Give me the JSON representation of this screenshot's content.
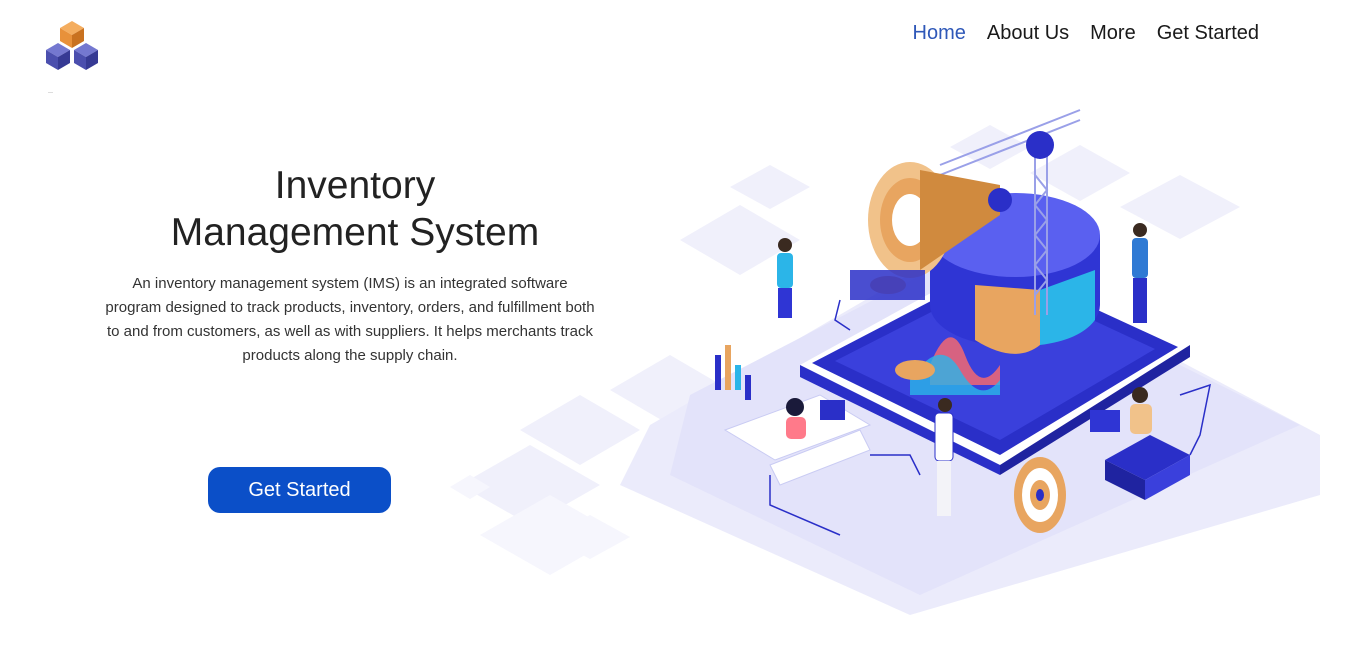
{
  "header": {
    "logo_icon": "stacked-cubes-icon",
    "nav": [
      {
        "label": "Home",
        "active": true
      },
      {
        "label": "About Us",
        "active": false
      },
      {
        "label": "More",
        "active": false
      },
      {
        "label": "Get Started",
        "active": false
      }
    ]
  },
  "hero": {
    "title_line1": "Inventory",
    "title_line2": "Management System",
    "description": "An inventory management system (IMS) is an integrated software program designed to track products, inventory, orders, and fulfillment both to and from customers, as well as with suppliers. It helps merchants track products along the supply chain.",
    "cta_label": "Get Started"
  },
  "colors": {
    "nav_active": "#2f58b8",
    "cta": "#0b4fc8",
    "cube_orange": "#e8913a",
    "cube_purple": "#4b4fae",
    "illustration_primary": "#2a2fc8",
    "illustration_tint": "#e8e8fb"
  }
}
